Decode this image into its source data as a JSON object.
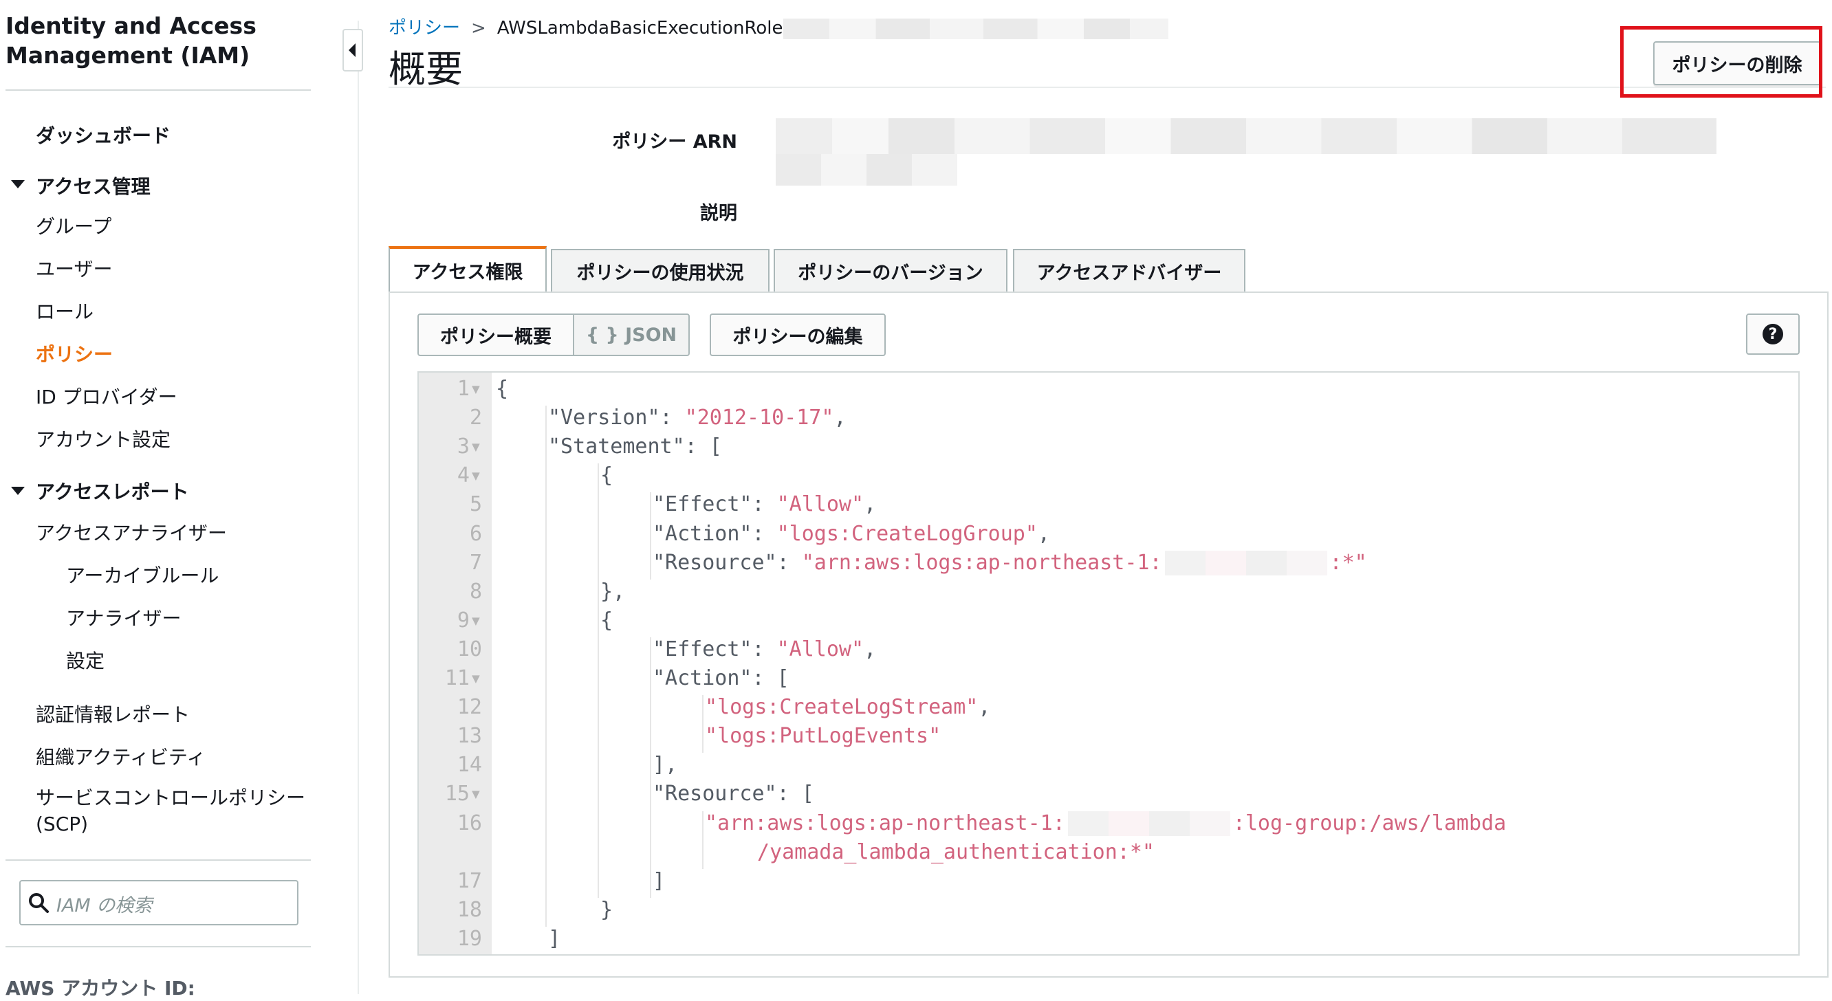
{
  "sidebar": {
    "title": "Identity and Access\nManagement (IAM)",
    "dashboard": "ダッシュボード",
    "access_mgmt": "アクセス管理",
    "groups": "グループ",
    "users": "ユーザー",
    "roles": "ロール",
    "policies": "ポリシー",
    "id_providers": "ID プロバイダー",
    "account_settings": "アカウント設定",
    "access_reports": "アクセスレポート",
    "access_analyzer": "アクセスアナライザー",
    "archive_rules": "アーカイブルール",
    "analyzers": "アナライザー",
    "settings": "設定",
    "credential_report": "認証情報レポート",
    "org_activity": "組織アクティビティ",
    "scp": "サービスコントロールポリシー\n(SCP)",
    "search_placeholder": "IAM の検索",
    "account_id_label": "AWS アカウント ID:"
  },
  "breadcrumb": {
    "parent": "ポリシー",
    "sep": ">",
    "current": "AWSLambdaBasicExecutionRole"
  },
  "header": {
    "title": "概要",
    "delete_button": "ポリシーの削除"
  },
  "summary": {
    "arn_label": "ポリシー ARN",
    "description_label": "説明"
  },
  "tabs": [
    "アクセス権限",
    "ポリシーの使用状況",
    "ポリシーのバージョン",
    "アクセスアドバイザー"
  ],
  "toolbar": {
    "summary_btn": "ポリシー概要",
    "json_btn": "{ } JSON",
    "edit_btn": "ポリシーの編集",
    "help": "?"
  },
  "editor": {
    "line_numbers": [
      "1",
      "2",
      "3",
      "4",
      "5",
      "6",
      "7",
      "8",
      "9",
      "10",
      "11",
      "12",
      "13",
      "14",
      "15",
      "16",
      "",
      "17",
      "18",
      "19"
    ],
    "folds": [
      "1",
      "3",
      "4",
      "9",
      "11",
      "15"
    ],
    "lines": [
      {
        "text": "{",
        "indent": 0
      },
      {
        "key": "\"Version\": ",
        "val": "\"2012-10-17\"",
        "tail": ",",
        "indent": 1
      },
      {
        "key": "\"Statement\": [",
        "indent": 1
      },
      {
        "text": "{",
        "indent": 2
      },
      {
        "key": "\"Effect\": ",
        "val": "\"Allow\"",
        "tail": ",",
        "indent": 3
      },
      {
        "key": "\"Action\": ",
        "val": "\"logs:CreateLogGroup\"",
        "tail": ",",
        "indent": 3
      },
      {
        "key": "\"Resource\": ",
        "val": "\"arn:aws:logs:ap-northeast-1:",
        "blur": true,
        "val2": ":*\"",
        "indent": 3
      },
      {
        "text": "},",
        "indent": 2
      },
      {
        "text": "{",
        "indent": 2
      },
      {
        "key": "\"Effect\": ",
        "val": "\"Allow\"",
        "tail": ",",
        "indent": 3
      },
      {
        "key": "\"Action\": [",
        "indent": 3
      },
      {
        "val": "\"logs:CreateLogStream\"",
        "tail": ",",
        "indent": 4
      },
      {
        "val": "\"logs:PutLogEvents\"",
        "indent": 4
      },
      {
        "text": "],",
        "indent": 3
      },
      {
        "key": "\"Resource\": [",
        "indent": 3
      },
      {
        "val": "\"arn:aws:logs:ap-northeast-1:",
        "blur": true,
        "val2": ":log-group:/aws/lambda",
        "indent": 4
      },
      {
        "val": "/yamada_lambda_authentication:*\"",
        "indent": 5
      },
      {
        "text": "]",
        "indent": 3
      },
      {
        "text": "}",
        "indent": 2
      },
      {
        "text": "]",
        "indent": 1
      }
    ]
  },
  "colors": {
    "accent": "#ec7211",
    "link": "#0073bb",
    "string": "#d2637e",
    "highlight": "#e0121a"
  }
}
